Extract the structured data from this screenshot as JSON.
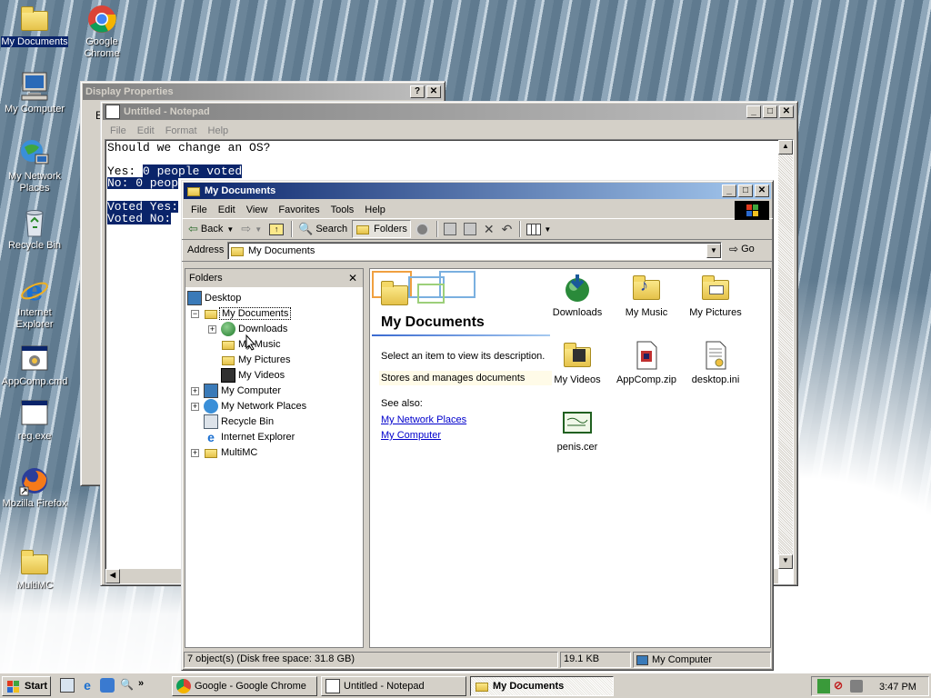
{
  "desktop": {
    "icons": [
      {
        "label": "My Documents"
      },
      {
        "label": "Google Chrome"
      },
      {
        "label": "My Computer"
      },
      {
        "label": "My Network Places"
      },
      {
        "label": "Recycle Bin"
      },
      {
        "label": "Internet Explorer"
      },
      {
        "label": "AppComp.cmd"
      },
      {
        "label": "reg.exe"
      },
      {
        "label": "Mozilla Firefox"
      },
      {
        "label": "MultiMC"
      }
    ]
  },
  "display_properties": {
    "title": "Display Properties",
    "help_btn": "?",
    "close_btn": "✕",
    "edge_char": "E"
  },
  "notepad": {
    "title": "Untitled - Notepad",
    "menu": [
      "File",
      "Edit",
      "Format",
      "Help"
    ],
    "lines": {
      "l1": "Should we change an OS?",
      "l2a": "Yes: ",
      "l2b": "0 people voted",
      "l3": "No: 0 peop",
      "l4": "Voted Yes:",
      "l5": "Voted No:"
    }
  },
  "explorer": {
    "title": "My Documents",
    "menu": [
      "File",
      "Edit",
      "View",
      "Favorites",
      "Tools",
      "Help"
    ],
    "toolbar": {
      "back": "Back",
      "search": "Search",
      "folders": "Folders"
    },
    "address_label": "Address",
    "address_value": "My Documents",
    "go": "Go",
    "folders_panel": {
      "header": "Folders",
      "close": "✕",
      "tree": [
        "Desktop",
        "My Documents",
        "Downloads",
        "My Music",
        "My Pictures",
        "My Videos",
        "My Computer",
        "My Network Places",
        "Recycle Bin",
        "Internet Explorer",
        "MultiMC"
      ]
    },
    "info": {
      "heading": "My Documents",
      "prompt": "Select an item to view its description.",
      "description": "Stores and manages documents",
      "see_also": "See also:",
      "links": [
        "My Network Places",
        "My Computer"
      ]
    },
    "files": [
      "Downloads",
      "My Music",
      "My Pictures",
      "My Videos",
      "AppComp.zip",
      "desktop.ini",
      "penis.cer"
    ],
    "status": {
      "objects": "7 object(s) (Disk free space: 31.8 GB)",
      "size": "19.1 KB",
      "zone": "My Computer"
    }
  },
  "taskbar": {
    "start": "Start",
    "tasks": [
      "Google - Google Chrome",
      "Untitled - Notepad",
      "My Documents"
    ],
    "clock": "3:47 PM",
    "chevron": "»"
  }
}
